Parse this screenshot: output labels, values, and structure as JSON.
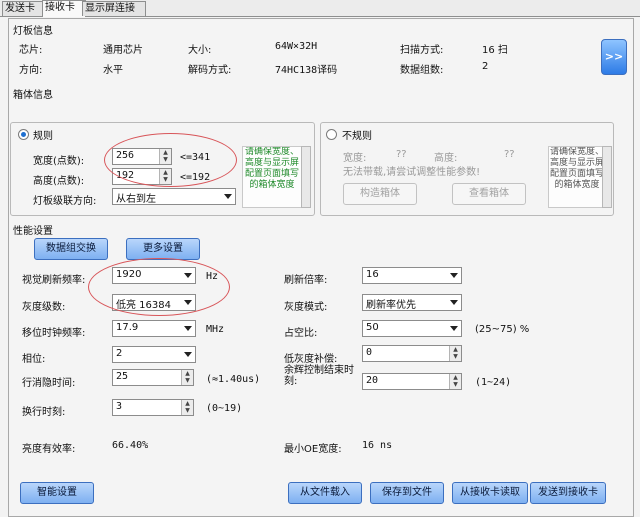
{
  "tabs": [
    "发送卡",
    "接收卡",
    "显示屏连接"
  ],
  "board_info": {
    "title": "灯板信息",
    "chip_label": "芯片:",
    "chip_value": "通用芯片",
    "size_label": "大小:",
    "size_value": "64W×32H",
    "scan_label": "扫描方式:",
    "scan_value": "16 扫",
    "dir_label": "方向:",
    "dir_value": "水平",
    "decode_label": "解码方式:",
    "decode_value": "74HC138译码",
    "groups_label": "数据组数:",
    "groups_value": "2",
    "next_button": ">>"
  },
  "cabinet_info": {
    "title": "箱体信息",
    "regular_label": "规则",
    "width_label": "宽度(点数):",
    "width_value": "256",
    "width_hint": "<=341",
    "height_label": "高度(点数):",
    "height_value": "192",
    "height_hint": "<=192",
    "cascade_label": "灯板级联方向:",
    "cascade_value": "从右到左",
    "note": "请确保宽度、高度与显示屏配置页面填写的箱体宽度",
    "irregular_label": "不规则",
    "irr_width_label": "宽度:",
    "irr_width_value": "??",
    "irr_height_label": "高度:",
    "irr_height_value": "??",
    "irr_message": "无法带载,请尝试调整性能参数!",
    "build_button": "构造箱体",
    "view_button": "查看箱体",
    "irr_note": "请确保宽度、高度与显示屏配置页面填写的箱体宽度"
  },
  "performance": {
    "title": "性能设置",
    "data_swap_button": "数据组交换",
    "more_button": "更多设置",
    "refresh_freq_label": "视觉刷新频率:",
    "refresh_freq_value": "1920",
    "refresh_freq_unit": "Hz",
    "refresh_mult_label": "刷新倍率:",
    "refresh_mult_value": "16",
    "gray_level_label": "灰度级数:",
    "gray_level_value": "低亮 16384",
    "gray_mode_label": "灰度模式:",
    "gray_mode_value": "刷新率优先",
    "shift_clock_label": "移位时钟频率:",
    "shift_clock_value": "17.9",
    "shift_clock_unit": "MHz",
    "duty_label": "占空比:",
    "duty_value": "50",
    "duty_range": "(25~75) %",
    "phase_label": "相位:",
    "phase_value": "2",
    "low_gray_label": "低灰度补偿:",
    "low_gray_value": "0",
    "blank_time_label": "行消隐时间:",
    "blank_time_value": "25",
    "blank_time_hint": "(≈1.40us)",
    "afterglow_label": "余辉控制结束时刻:",
    "afterglow_value": "20",
    "afterglow_range": "(1~24)",
    "line_change_label": "换行时刻:",
    "line_change_value": "3",
    "line_change_range": "(0~19)",
    "brightness_eff_label": "亮度有效率:",
    "brightness_eff_value": "66.40%",
    "min_oe_label": "最小OE宽度:",
    "min_oe_value": "16 ns"
  },
  "bottom": {
    "smart_button": "智能设置",
    "load_button": "从文件载入",
    "save_button": "保存到文件",
    "read_button": "从接收卡读取",
    "send_button": "发送到接收卡"
  }
}
